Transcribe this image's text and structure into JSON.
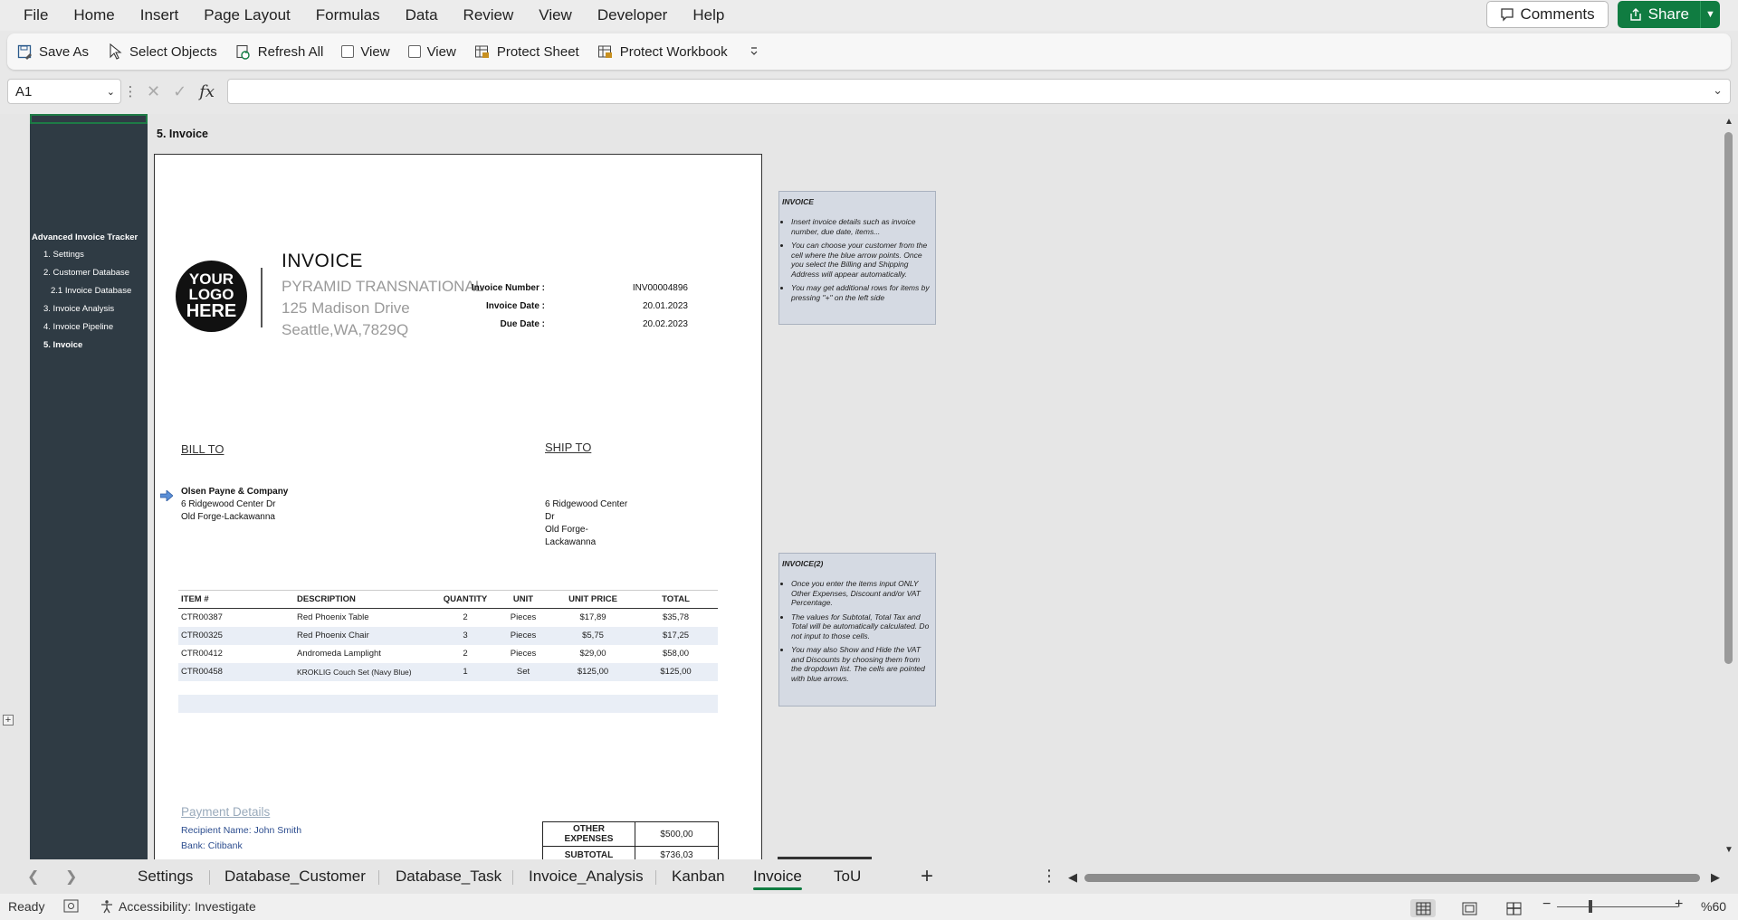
{
  "menu": [
    "File",
    "Home",
    "Insert",
    "Page Layout",
    "Formulas",
    "Data",
    "Review",
    "View",
    "Developer",
    "Help"
  ],
  "comments_label": "Comments",
  "share_label": "Share",
  "ribbon": {
    "save_as": "Save As",
    "select_objects": "Select Objects",
    "refresh_all": "Refresh All",
    "view1": "View",
    "view2": "View",
    "protect_sheet": "Protect Sheet",
    "protect_workbook": "Protect Workbook"
  },
  "formula_bar": {
    "name_box": "A1",
    "fx": "fx",
    "value": ""
  },
  "nav": {
    "title": "Advanced Invoice Tracker",
    "items": [
      "1. Settings",
      "2. Customer Database",
      "2.1 Invoice Database",
      "3. Invoice Analysis",
      "4. Invoice Pipeline",
      "5. Invoice"
    ]
  },
  "sheet_title": "5. Invoice",
  "invoice": {
    "logo_text": [
      "YOUR",
      "LOGO",
      "HERE"
    ],
    "heading": "INVOICE",
    "company": [
      "PYRAMID TRANSNATIONAL",
      "125 Madison Drive",
      "Seattle,WA,7829Q"
    ],
    "meta": [
      {
        "label": "Invoice Number :",
        "value": "INV00004896"
      },
      {
        "label": "Invoice Date :",
        "value": "20.01.2023"
      },
      {
        "label": "Due Date :",
        "value": "20.02.2023"
      }
    ],
    "bill_to": "BILL TO",
    "ship_to": "SHIP TO",
    "bill_lines": [
      "Olsen Payne & Company",
      "6 Ridgewood Center Dr",
      "Old Forge-Lackawanna"
    ],
    "ship_lines": [
      "6 Ridgewood Center",
      "Dr",
      "Old Forge-",
      "Lackawanna"
    ],
    "columns": [
      "ITEM #",
      "DESCRIPTION",
      "QUANTITY",
      "UNIT",
      "UNIT PRICE",
      "TOTAL"
    ],
    "rows": [
      [
        "CTR00387",
        "Red Phoenix Table",
        "2",
        "Pieces",
        "$17,89",
        "$35,78"
      ],
      [
        "CTR00325",
        "Red Phoenix Chair",
        "3",
        "Pieces",
        "$5,75",
        "$17,25"
      ],
      [
        "CTR00412",
        "Andromeda Lamplight",
        "2",
        "Pieces",
        "$29,00",
        "$58,00"
      ],
      [
        "CTR00458",
        "KROKLIG Couch Set (Navy Blue)",
        "1",
        "Set",
        "$125,00",
        "$125,00"
      ]
    ],
    "payment_heading": "Payment Details",
    "payment_lines": [
      "Recipient Name: John Smith",
      "Bank: Citibank"
    ],
    "totals": [
      {
        "label": "OTHER EXPENSES",
        "value": "$500,00"
      },
      {
        "label": "SUBTOTAL",
        "value": "$736,03"
      }
    ]
  },
  "notes": [
    {
      "title": "INVOICE",
      "items": [
        "Insert invoice details such as invoice number, due date, items...",
        "You can choose your customer from the cell where the blue arrow points. Once you select the Billing and Shipping Address will appear automatically.",
        "You may get additional rows for items by pressing \"+\" on the left side"
      ]
    },
    {
      "title": "INVOICE(2)",
      "items": [
        "Once you enter the items input ONLY Other Expenses, Discount and/or VAT Percentage.",
        "The values for Subtotal, Total Tax and Total will be automatically calculated. Do not input to those cells.",
        "You may also Show and Hide the VAT and Discounts by choosing them from the dropdown list. The cells are pointed with blue arrows."
      ]
    }
  ],
  "tabs": [
    "Settings",
    "Database_Customer",
    "Database_Task",
    "Invoice_Analysis",
    "Kanban",
    "Invoice",
    "ToU"
  ],
  "active_tab": "Invoice",
  "status": {
    "ready": "Ready",
    "accessibility": "Accessibility: Investigate",
    "zoom": "%60"
  },
  "colors": {
    "accent": "#107c41",
    "nav_bg": "#2f3b44",
    "note_bg": "#d5dae3",
    "row_alt": "#e9eef6"
  }
}
